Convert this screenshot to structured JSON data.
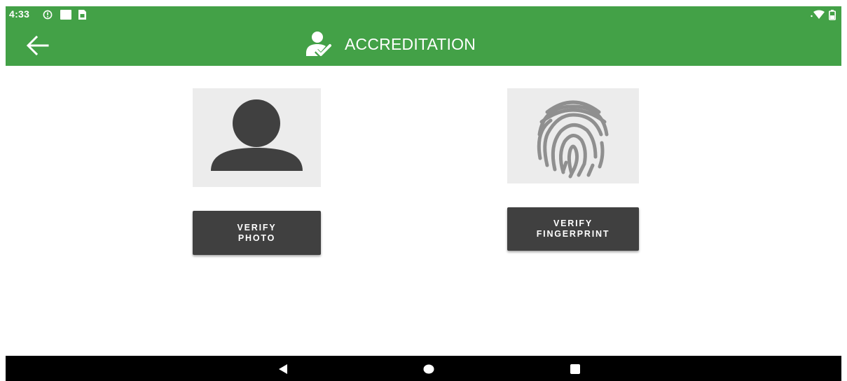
{
  "status_bar": {
    "time": "4:33",
    "icons": [
      "alert-circle-icon",
      "square-notification-icon",
      "sim-card-icon",
      "wifi-icon",
      "battery-icon"
    ]
  },
  "app_bar": {
    "title": "ACCREDITATION",
    "back_icon": "arrow-left-icon",
    "title_icon": "user-check-icon",
    "color": "#43a147"
  },
  "verification": {
    "photo": {
      "icon": "person-silhouette-icon",
      "button_line1": "VERIFY",
      "button_line2": "PHOTO"
    },
    "fingerprint": {
      "icon": "fingerprint-icon",
      "button_line1": "VERIFY",
      "button_line2": "FINGERPRINT"
    },
    "button_color": "#404040",
    "card_color": "#ececec"
  },
  "nav_bar": {
    "buttons": [
      "back-triangle-icon",
      "home-circle-icon",
      "recents-square-icon"
    ]
  }
}
